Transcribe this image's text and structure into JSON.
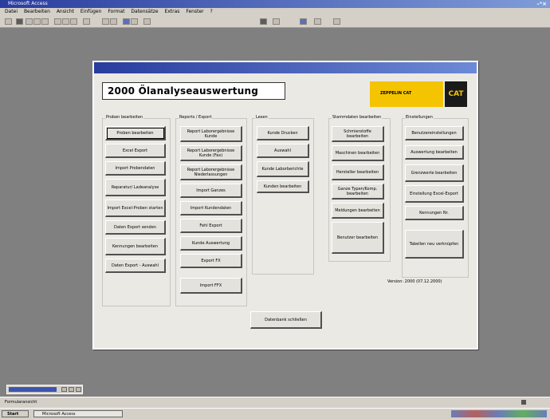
{
  "titlebar": {
    "title": "Microsoft Access",
    "controls": "–ᵃ×"
  },
  "menubar": {
    "items": [
      "Datei",
      "Bearbeiten",
      "Ansicht",
      "Einfügen",
      "Format",
      "Datensätze",
      "Extras",
      "Fenster",
      "?"
    ]
  },
  "toolbar": {
    "buttons": [
      "design-view",
      "save",
      "print",
      "preview",
      "spelling",
      "cut",
      "copy",
      "paste",
      "undo",
      "sort-ascending",
      "sort-descending",
      "filter",
      "apply-filter",
      "find",
      "new-record",
      "delete-record",
      "database-window",
      "new-object",
      "help"
    ]
  },
  "form": {
    "title": "2000 Ölanalyseauswertung",
    "brand_text": "ZEPPELIN CAT",
    "brand_logo": "CAT",
    "groups": {
      "pruefen": {
        "label": "Proben bearbeiten",
        "buttons": [
          "Proben bearbeiten",
          "Excel Export",
          "Import Probendaten",
          "Reparatur/ Ladeanalyse",
          "Import Excel-Proben starten",
          "Daten Export senden",
          "Kennungen bearbeiten",
          "Daten Export - Auswahl"
        ]
      },
      "reports": {
        "label": "Reports / Export",
        "buttons": [
          "Report Laborergebnisse Kunde",
          "Report Laborergebnisse Kunde (Fax)",
          "Report Laborergebnisse Niederlassungen",
          "Import Ganzes",
          "Import Kundendaten",
          "Fehl Export",
          "Kunde Auswertung",
          "Export FX",
          "Import FFX"
        ]
      },
      "lesen": {
        "label": "Lesen",
        "buttons": [
          "Kunde Drucken",
          "Auswahl",
          "Kunde Laborberichte",
          "Kunden bearbeiten"
        ]
      },
      "stammdaten": {
        "label": "Stammdaten bearbeiten",
        "buttons": [
          "Schmierstoffe bearbeiten",
          "Maschinen bearbeiten",
          "Hersteller bearbeiten",
          "Ganze Typen/Komp. bearbeiten",
          "Meldungen bearbeiten",
          "Benutzer bearbeiten"
        ]
      },
      "einstellungen": {
        "label": "Einstellungen",
        "buttons": [
          "Benutzereinstellungen",
          "Auswertung bearbeiten",
          "Grenzwerte bearbeiten",
          "Einstellung Excel-Export",
          "Kennungen Nr."
        ]
      }
    },
    "actions": {
      "close_access": "Datenbank schließen",
      "finish_work": "Tabellen neu verknüpfen"
    },
    "version": "Version: 2000 (07.12.2000)"
  },
  "statusbar": {
    "text": "Formularansicht"
  },
  "taskbar": {
    "start": "Start",
    "task": "Microsoft Access"
  },
  "colors": {
    "desktop": "#808080",
    "title_bar": "#2a3d9e",
    "brand_yellow": "#f5c400",
    "brand_black": "#1a1a1a"
  }
}
